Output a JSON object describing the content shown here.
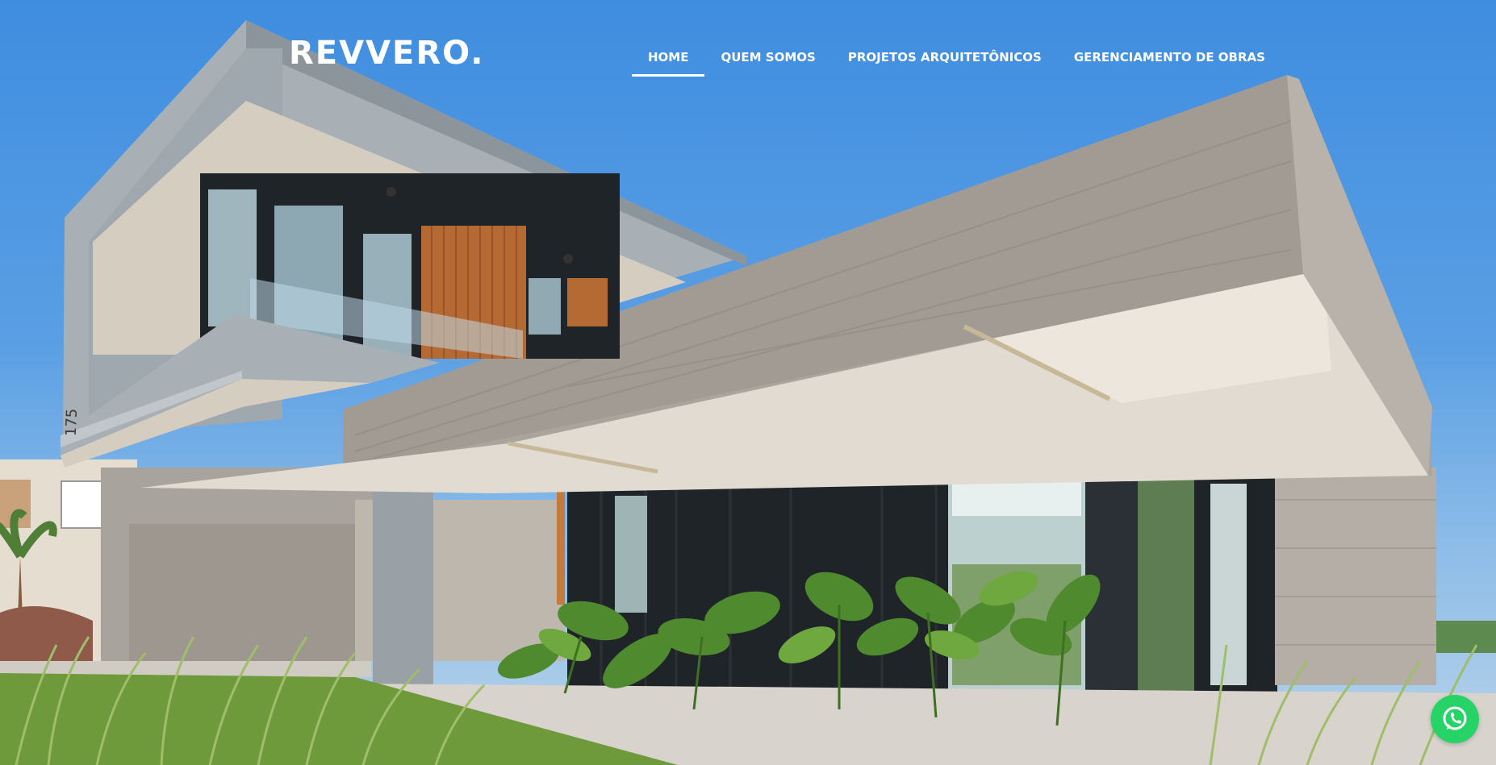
{
  "brand": {
    "logo_text": "REVVERO."
  },
  "nav": {
    "items": [
      {
        "label": "HOME",
        "active": true
      },
      {
        "label": "QUEM SOMOS",
        "active": false
      },
      {
        "label": "PROJETOS ARQUITETÔNICOS",
        "active": false
      },
      {
        "label": "GERENCIAMENTO DE OBRAS",
        "active": false
      }
    ]
  },
  "hero": {
    "house_number": "175"
  },
  "whatsapp": {
    "icon": "whatsapp-icon",
    "color": "#25d366"
  }
}
